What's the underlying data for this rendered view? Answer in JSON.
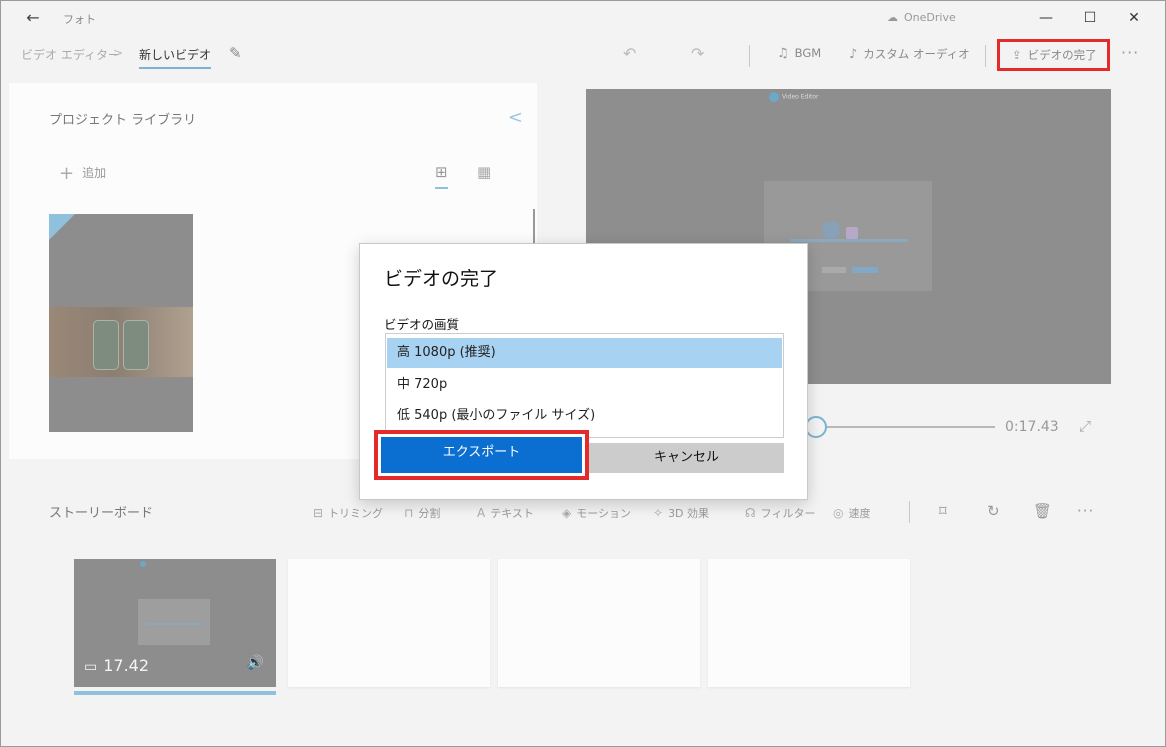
{
  "titlebar": {
    "back_glyph": "←",
    "app_title": "フォト",
    "onedrive_label": "OneDrive",
    "minimize": "—",
    "maximize": "☐",
    "close": "✕"
  },
  "breadcrumb": {
    "parent": "ビデオ エディター",
    "separator": ">",
    "current": "新しいビデオ"
  },
  "toolbar": {
    "undo_glyph": "↶",
    "redo_glyph": "↷",
    "bgm_label": "BGM",
    "custom_audio_label": "カスタム オーディオ",
    "finish_video_label": "ビデオの完了",
    "more_glyph": "···"
  },
  "library": {
    "title": "プロジェクト ライブラリ",
    "add_label": "追加",
    "collapse_glyph": "<",
    "view_large_glyph": "⊞",
    "view_small_glyph": "▦"
  },
  "preview": {
    "logo_text": "Video Editor",
    "time": "0:17.43",
    "expand_glyph": "⤢"
  },
  "storyboard": {
    "title": "ストーリーボード",
    "tools": {
      "trim": "トリミング",
      "split": "分割",
      "text": "テキスト",
      "motion": "モーション",
      "effects3d": "3D 効果",
      "filter": "フィルター",
      "speed": "速度"
    },
    "more_glyph": "···",
    "clips": [
      {
        "duration": "17.42"
      }
    ]
  },
  "dialog": {
    "title": "ビデオの完了",
    "quality_label": "ビデオの画質",
    "options": [
      "高 1080p (推奨)",
      "中 720p",
      "低 540p (最小のファイル サイズ)"
    ],
    "selected_option": "高 1080p (推奨)",
    "export_label": "エクスポート",
    "cancel_label": "キャンセル"
  },
  "colors": {
    "accent": "#0a6fd1",
    "selection": "#a8d2f2",
    "highlight_box": "#e42b2b",
    "overlay_gray": "#8e8e8e"
  },
  "icons": {
    "back": "arrow-left-icon",
    "onedrive": "cloud-off-icon",
    "edit": "pencil-icon",
    "bgm": "music-note-icon",
    "custom_audio": "person-audio-icon",
    "finish": "share-icon",
    "add": "plus-icon",
    "duration": "film-icon",
    "volume": "speaker-icon",
    "crop": "crop-icon",
    "rotate": "rotate-icon",
    "delete": "trash-icon"
  }
}
